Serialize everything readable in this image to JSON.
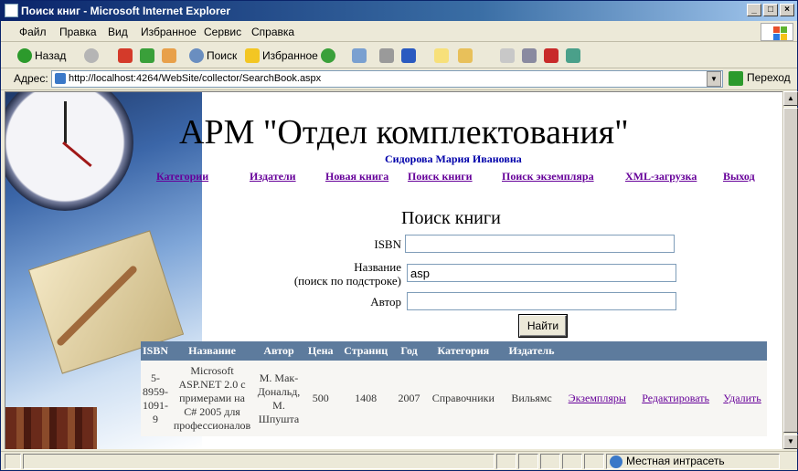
{
  "window": {
    "title": "Поиск книг - Microsoft Internet Explorer"
  },
  "menu": [
    "Файл",
    "Правка",
    "Вид",
    "Избранное",
    "Сервис",
    "Справка"
  ],
  "toolbar": {
    "back": "Назад",
    "search": "Поиск",
    "favorites": "Избранное"
  },
  "address": {
    "label": "Адрес:",
    "url": "http://localhost:4264/WebSite/collector/SearchBook.aspx",
    "go": "Переход"
  },
  "page": {
    "heading": "АРМ \"Отдел комплектования\"",
    "user": "Сидорова Мария Ивановна",
    "nav": [
      "Категории",
      "Издатели",
      "Новая книга",
      "Поиск книги",
      "Поиск экземпляра",
      "XML-загрузка",
      "Выход"
    ],
    "form_title": "Поиск книги",
    "isbn_label": "ISBN",
    "isbn_value": "",
    "title_label_1": "Название",
    "title_label_2": "(поиск по подстроке)",
    "title_value": "asp",
    "author_label": "Автор",
    "author_value": "",
    "submit": "Найти"
  },
  "results": {
    "columns": [
      "ISBN",
      "Название",
      "Автор",
      "Цена",
      "Страниц",
      "Год",
      "Категория",
      "Издатель"
    ],
    "rows": [
      {
        "isbn": "5-8959-1091-9",
        "title": "Microsoft ASP.NET 2.0 с примерами на C# 2005 для профессионалов",
        "author": "М. Мак-Дональд, М. Шпушта",
        "price": "500",
        "pages": "1408",
        "year": "2007",
        "category": "Справочники",
        "publisher": "Вильямс",
        "copies": "Экземпляры",
        "edit": "Редактировать",
        "delete": "Удалить"
      }
    ]
  },
  "status": {
    "zone": "Местная интрасеть"
  }
}
